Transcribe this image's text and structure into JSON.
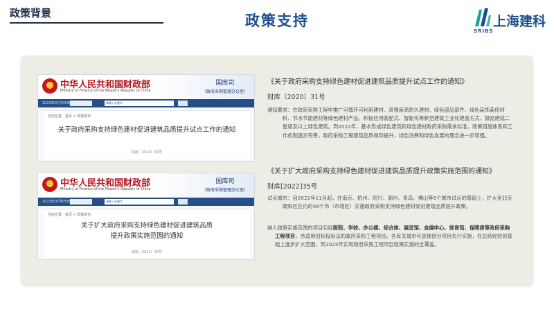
{
  "header": {
    "section_label": "政策背景",
    "title": "政策支持",
    "logo": {
      "name": "上海建科",
      "abbr": "SRIBS"
    }
  },
  "docs": [
    {
      "ministry_cn": "中华人民共和国财政部",
      "ministry_en": "Ministry of Finance of the People's Republic of China",
      "dept": "国库司",
      "dept_sub": "（政府采购管理办公室）",
      "nav_date": "2023年07月05日",
      "nav_search": "请输入关键字",
      "breadcrumb": "当前位置：首页 > 政策发布",
      "title_lines": [
        "关于政府采购支持绿色建材促进建筑品质提升试点工作的通知"
      ],
      "doc_no": "财库〔2020〕31号"
    },
    {
      "ministry_cn": "中华人民共和国财政部",
      "ministry_en": "Ministry of Finance of the People's Republic of China",
      "dept": "国库司",
      "dept_sub": "（政府采购管理办公室）",
      "nav_date": "2023年07月05日",
      "nav_search": "请输入关键字",
      "breadcrumb": "当前位置：首页 > 政策发布",
      "title_lines": [
        "关于扩大政府采购支持绿色建材促进建筑品质",
        "提升政策实施范围的通知"
      ],
      "doc_no": "财库〔2022〕35号"
    }
  ],
  "policies": [
    {
      "title": "《关于政府采购支持绿色建材促进建筑品质提升试点工作的通知》",
      "number": "财库〔2020〕31号",
      "label": "通知要求：",
      "text": "在政府采购工程中推广可循环可利用建材、高强度高耐久建材、绿色部品部件、绿色装饰装修材料、节水节能建材等绿色建材产品，积极应用装配式、智能化等新型建筑工业化建造方式，鼓励建成二星级及以上绿色建筑。到2022年，基本形成绿色建筑和绿色建材政府采购需求标准，政策措施体系和工作机制逐步完善，政府采购工程建筑品质得到提升，绿色消费和绿色发展的理念进一步增强。"
    },
    {
      "title": "《关于扩大政府采购支持绿色建材促进建筑品质提升政策实施范围的通知》",
      "number": "财库[2022]35号",
      "label": "试点城市：",
      "text": "自2022年11月起，在南京、杭州、绍兴、湖州、青岛、佛山等6个城市试点的基础上，扩大至北京朝阳区在内的48个市（市辖区）实施政府采购支持绿色建材促进建筑品质提升政策。",
      "scope": {
        "lead": "纳入政策实施范围的项目包括",
        "bold1": "医院、学校、办公楼、综合体、展览馆、会展中心、体育馆、保障房等政府采购工程项目",
        "tail": "，含适用招标投标法的政府采购工程项目。各有关城市可选择部分项目先行实施，在总结经验的基础上逐步扩大范围，到2025年实现政府采购工程项目政策实施的全覆盖。"
      }
    }
  ]
}
